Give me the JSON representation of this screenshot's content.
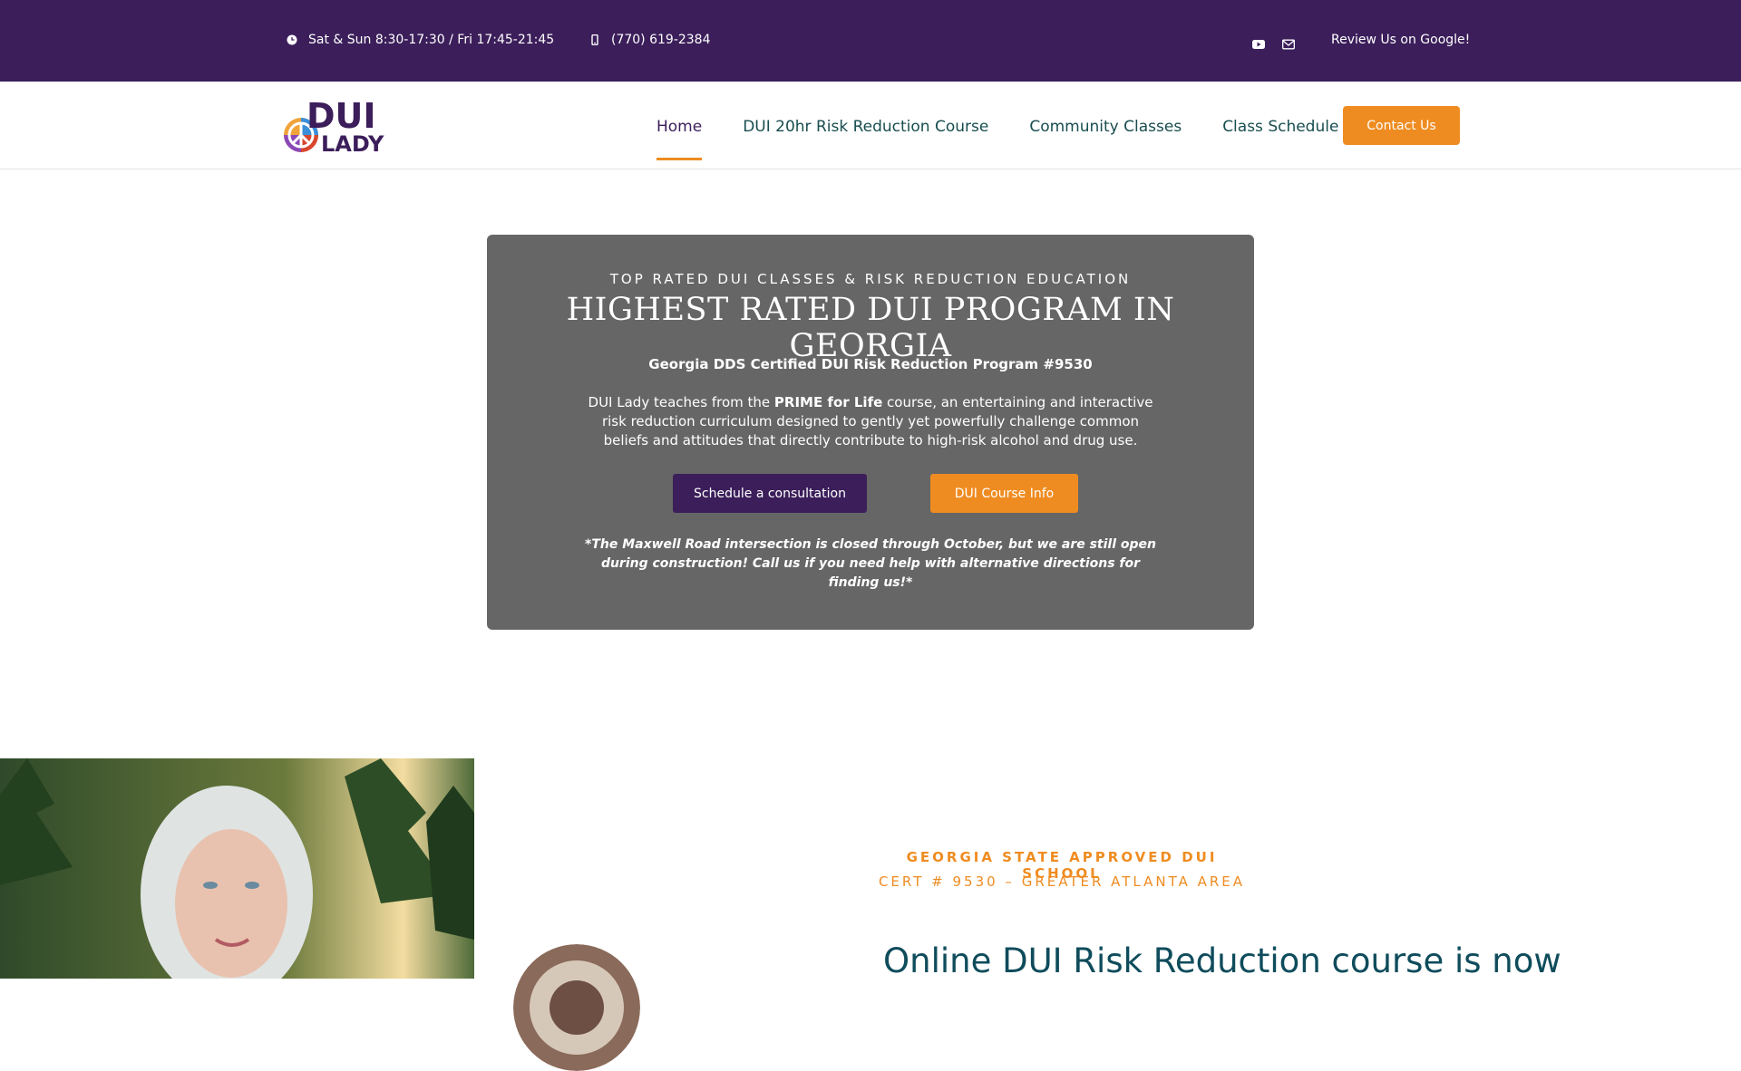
{
  "topbar": {
    "hours": "Sat & Sun 8:30-17:30 / Fri 17:45-21:45",
    "phone": "(770) 619-2384",
    "review": "Review Us on Google!",
    "icons": [
      "clock-icon",
      "phone-icon",
      "youtube-icon",
      "email-icon"
    ]
  },
  "nav": {
    "items": [
      {
        "label": "Home",
        "active": true
      },
      {
        "label": "DUI 20hr Risk Reduction Course",
        "active": false
      },
      {
        "label": "Community Classes",
        "active": false
      },
      {
        "label": "Class Schedule",
        "active": false
      }
    ],
    "contact": "Contact Us"
  },
  "logo": {
    "line1": "DUI",
    "line2": "LADY"
  },
  "hero": {
    "eyebrow": "TOP RATED DUI CLASSES & RISK REDUCTION EDUCATION",
    "title": "HIGHEST RATED DUI PROGRAM IN GEORGIA",
    "cert": "Georgia DDS Certified DUI Risk Reduction Program #9530",
    "desc_before": "DUI Lady teaches from the ",
    "desc_bold": "PRIME for Life",
    "desc_after": " course, an entertaining and interactive risk reduction curriculum designed to gently yet powerfully challenge common beliefs and attitudes that directly contribute to high-risk alcohol and drug use.",
    "btn_schedule": "Schedule a consultation",
    "btn_course": "DUI Course Info",
    "notice": "*The Maxwell Road intersection is closed through October, but we are still open during construction! Call us if you need help with alternative directions for finding us!*"
  },
  "section": {
    "sub1": "GEORGIA STATE APPROVED DUI SCHOOL",
    "sub2": "CERT # 9530 – GREATER ATLANTA AREA",
    "title": "Online DUI Risk Reduction course is now"
  },
  "colors": {
    "purple": "#3b1e5a",
    "orange": "#ef8c21",
    "teal": "#0f4c5c",
    "hero_bg": "#666666"
  }
}
